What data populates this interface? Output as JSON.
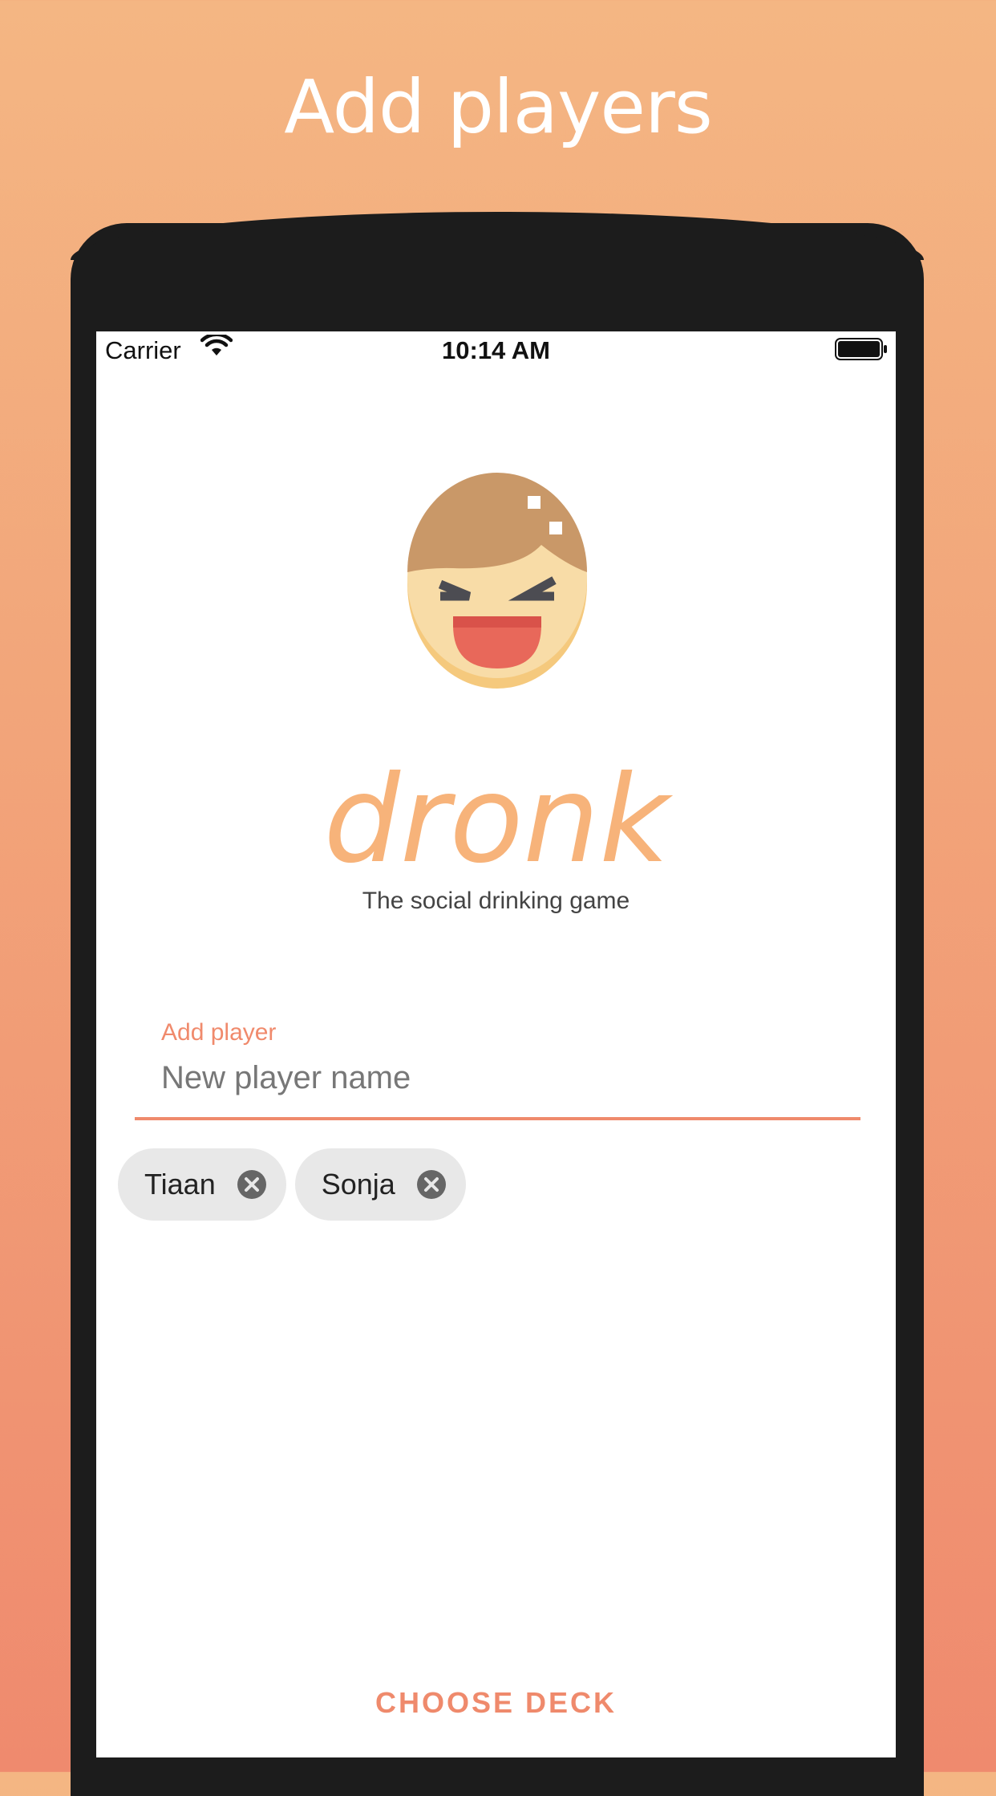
{
  "headline": "Add players",
  "status_bar": {
    "carrier": "Carrier",
    "time": "10:14 AM"
  },
  "app": {
    "brand": "dronk",
    "tagline": "The social drinking game"
  },
  "player_field": {
    "label": "Add player",
    "placeholder": "New player name",
    "value": ""
  },
  "players": [
    {
      "name": "Tiaan"
    },
    {
      "name": "Sonja"
    }
  ],
  "actions": {
    "choose_deck": "CHOOSE DECK"
  },
  "colors": {
    "accent": "#ef8a6c",
    "brand": "#f7b37a",
    "phone_frame": "#1c1c1c"
  }
}
